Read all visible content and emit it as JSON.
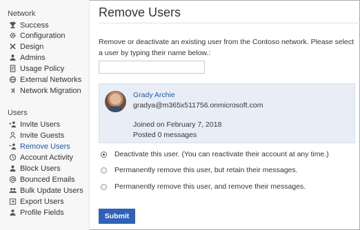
{
  "sidebar": {
    "network_title": "Network",
    "network_items": [
      {
        "label": "Success",
        "icon": "trophy-icon"
      },
      {
        "label": "Configuration",
        "icon": "gear-icon"
      },
      {
        "label": "Design",
        "icon": "design-icon"
      },
      {
        "label": "Admins",
        "icon": "admin-icon"
      },
      {
        "label": "Usage Policy",
        "icon": "document-icon"
      },
      {
        "label": "External Networks",
        "icon": "globe-icon"
      },
      {
        "label": "Network Migration",
        "icon": "migration-icon"
      }
    ],
    "users_title": "Users",
    "user_items": [
      {
        "label": "Invite Users",
        "icon": "invite-user-icon"
      },
      {
        "label": "Invite Guests",
        "icon": "invite-guest-icon"
      },
      {
        "label": "Remove Users",
        "icon": "remove-user-icon",
        "active": true
      },
      {
        "label": "Account Activity",
        "icon": "clock-icon"
      },
      {
        "label": "Block Users",
        "icon": "block-icon"
      },
      {
        "label": "Bounced Emails",
        "icon": "at-icon"
      },
      {
        "label": "Bulk Update Users",
        "icon": "group-icon"
      },
      {
        "label": "Export Users",
        "icon": "export-icon"
      },
      {
        "label": "Profile Fields",
        "icon": "profile-icon"
      }
    ]
  },
  "main": {
    "title": "Remove Users",
    "description": "Remove or deactivate an existing user from the Contoso network. Please select a user by typing their name below.:",
    "search_value": "",
    "user": {
      "name": "Grady Archie",
      "email": "gradya@m365x511756.onmicrosoft.com",
      "joined": "Joined on February 7, 2018",
      "posted": "Posted 0 messages"
    },
    "options": [
      {
        "label": "Deactivate this user. (You can reactivate their account at any time.)",
        "checked": true
      },
      {
        "label": "Permanently remove this user, but retain their messages.",
        "checked": false
      },
      {
        "label": "Permanently remove this user, and remove their messages.",
        "checked": false
      }
    ],
    "submit_label": "Submit"
  },
  "colors": {
    "accent": "#1e5aa8",
    "button": "#2f62b7",
    "card_bg": "#e9eef6"
  }
}
